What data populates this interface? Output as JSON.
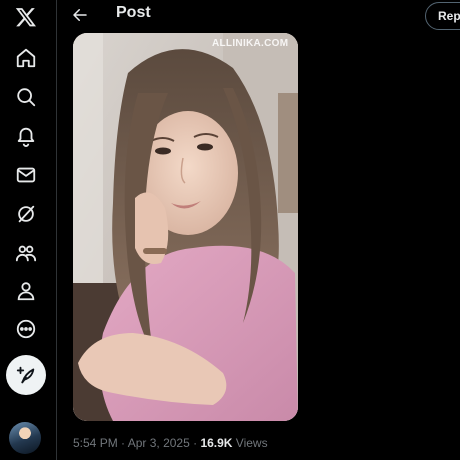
{
  "header": {
    "title": "Post",
    "reply_label": "Repl"
  },
  "sidebar": {
    "items": [
      {
        "icon": "x-logo-icon"
      },
      {
        "icon": "home-icon"
      },
      {
        "icon": "search-icon"
      },
      {
        "icon": "bell-icon"
      },
      {
        "icon": "mail-icon"
      },
      {
        "icon": "grok-icon"
      },
      {
        "icon": "communities-icon"
      },
      {
        "icon": "profile-icon"
      },
      {
        "icon": "more-icon"
      }
    ],
    "compose_icon": "feather-plus-icon"
  },
  "post": {
    "watermark": "ALLINIKA.COM",
    "time": "5:54 PM",
    "separator": " · ",
    "date": "Apr 3, 2025",
    "views_count": "16.9K",
    "views_label": " Views"
  },
  "colors": {
    "background": "#000000",
    "text_primary": "#e7e9ea",
    "text_secondary": "#71767b",
    "border": "#2f3336",
    "compose_button": "#eff3f4"
  }
}
